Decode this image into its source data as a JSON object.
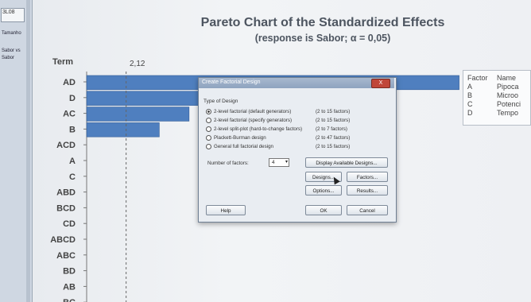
{
  "sidebar": {
    "mini_label": "3L08",
    "nav_items": [
      "Tamanho",
      "Sabor vs",
      "Sabor"
    ]
  },
  "chart_data": {
    "type": "bar",
    "title": "Pareto Chart of the Standardized Effects",
    "subtitle": "(response is Sabor; α = 0,05)",
    "term_header": "Term",
    "reference_value": 2.12,
    "reference_label": "2,12",
    "categories": [
      "AD",
      "D",
      "AC",
      "B",
      "ACD",
      "A",
      "C",
      "ABD",
      "BCD",
      "CD",
      "ABCD",
      "ABC",
      "BD",
      "AB",
      "BC"
    ],
    "values": [
      20.0,
      9.8,
      5.5,
      3.9,
      null,
      null,
      null,
      null,
      null,
      null,
      null,
      null,
      null,
      null,
      null
    ],
    "bar_color": "#4f7fbf",
    "xlim": [
      0,
      21
    ]
  },
  "legend": {
    "header_factor": "Factor",
    "header_name": "Name",
    "rows": [
      {
        "factor": "A",
        "name": "Pipoca"
      },
      {
        "factor": "B",
        "name": "Microo"
      },
      {
        "factor": "C",
        "name": "Potenci"
      },
      {
        "factor": "D",
        "name": "Tempo"
      }
    ]
  },
  "dialog": {
    "title": "Create Factorial Design",
    "close": "X",
    "group_label": "Type of Design",
    "options": [
      {
        "label": "2-level factorial (default generators)",
        "range": "(2 to 15 factors)",
        "selected": true
      },
      {
        "label": "2-level factorial (specify generators)",
        "range": "(2 to 15 factors)",
        "selected": false
      },
      {
        "label": "2-level split-plot (hard-to-change factors)",
        "range": "(2 to 7 factors)",
        "selected": false
      },
      {
        "label": "Plackett-Burman design",
        "range": "(2 to 47 factors)",
        "selected": false
      },
      {
        "label": "General full factorial design",
        "range": "(2 to 15 factors)",
        "selected": false
      }
    ],
    "num_factors_label": "Number of factors:",
    "num_factors_value": "4",
    "buttons": {
      "display": "Display Available Designs...",
      "designs": "Designs...",
      "factors": "Factors...",
      "options": "Options...",
      "results": "Results...",
      "help": "Help",
      "ok": "OK",
      "cancel": "Cancel"
    }
  }
}
